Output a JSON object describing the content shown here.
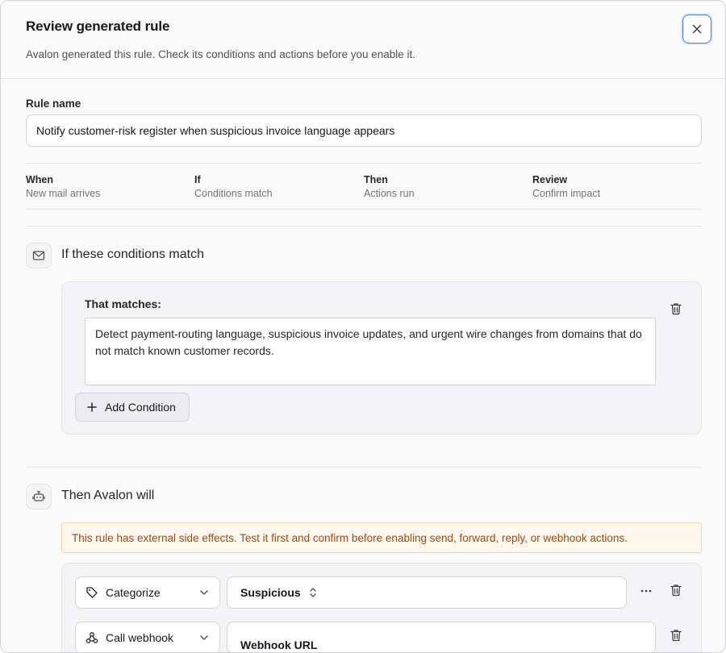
{
  "header": {
    "title": "Review generated rule",
    "subtitle": "Avalon generated this rule. Check its conditions and actions before you enable it.",
    "close_icon": "close-icon"
  },
  "rule_name": {
    "label": "Rule name",
    "value": "Notify customer-risk register when suspicious invoice language appears"
  },
  "steps": [
    {
      "title": "When",
      "sub": "New mail arrives"
    },
    {
      "title": "If",
      "sub": "Conditions match"
    },
    {
      "title": "Then",
      "sub": "Actions run"
    },
    {
      "title": "Review",
      "sub": "Confirm impact"
    }
  ],
  "conditions": {
    "icon": "mail-icon",
    "title": "If these conditions match",
    "label": "That matches:",
    "text": "Detect payment-routing language, suspicious invoice updates, and urgent wire changes from domains that do not match known customer records.",
    "add_label": "Add Condition"
  },
  "actions": {
    "icon": "bot-icon",
    "title": "Then Avalon will",
    "warning": "This rule has external side effects. Test it first and confirm before enabling send, forward, reply, or webhook actions.",
    "items": [
      {
        "type": "Categorize",
        "icon": "tag-icon",
        "value": "Suspicious"
      },
      {
        "type": "Call webhook",
        "icon": "webhook-icon",
        "value": "Webhook URL"
      }
    ]
  },
  "colors": {
    "accent": "#3b82c4",
    "warning_bg": "#fff7ed",
    "warning_text": "#9a4a12"
  }
}
